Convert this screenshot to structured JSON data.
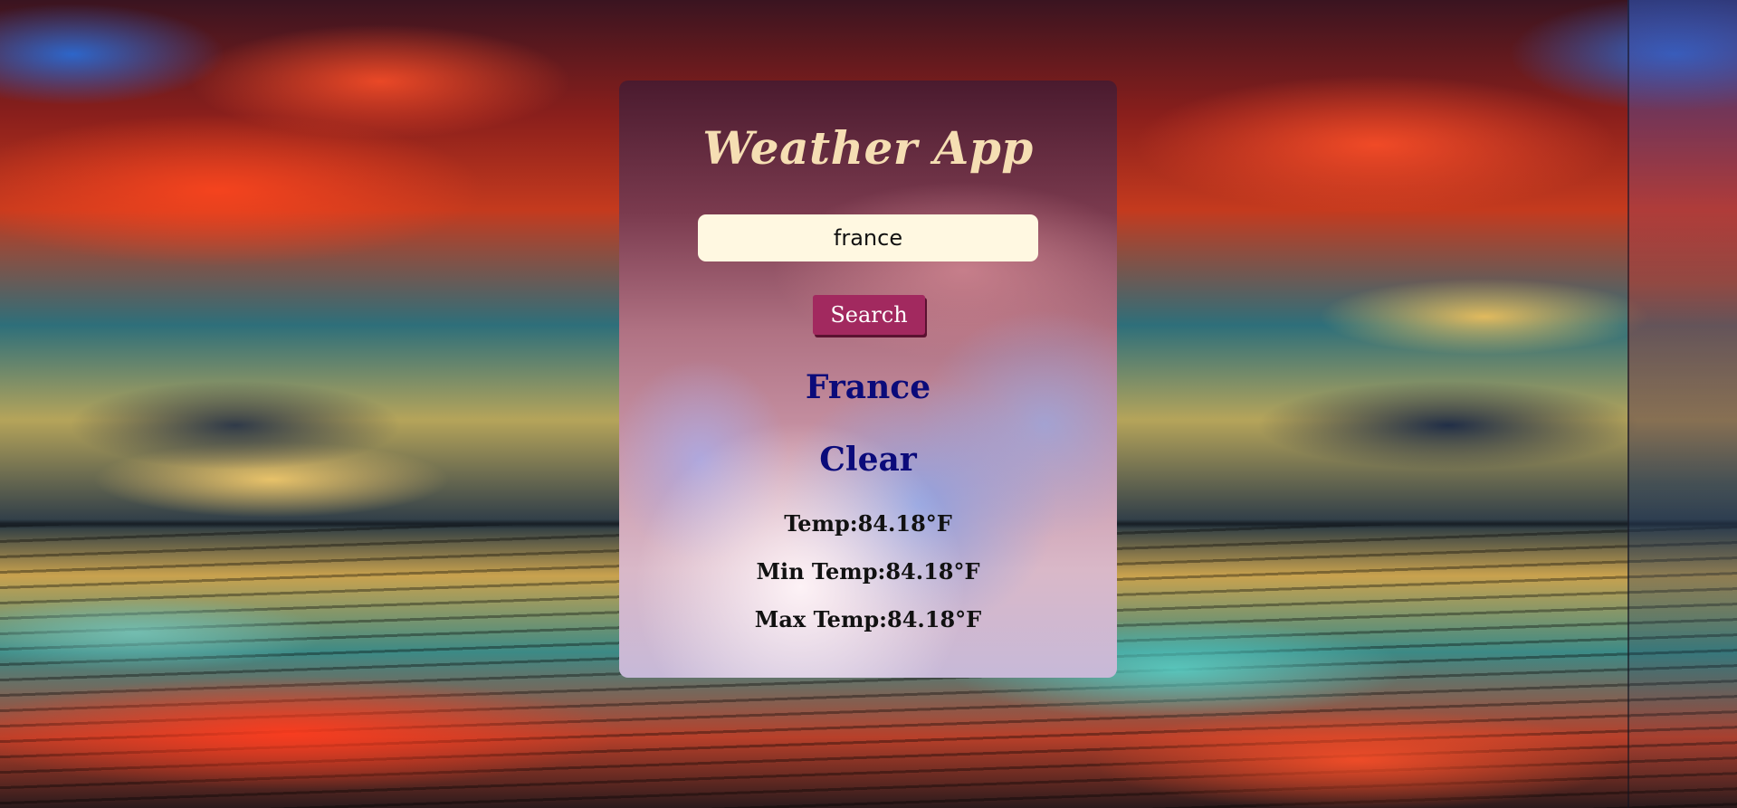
{
  "app": {
    "title": "Weather App"
  },
  "search": {
    "value": "france",
    "placeholder": "",
    "button_label": "Search"
  },
  "result": {
    "city": "France",
    "condition": "Clear",
    "temp_label": "Temp:",
    "temp_value": "84.18°F",
    "min_label": "Min Temp:",
    "min_value": "84.18°F",
    "max_label": "Max Temp:",
    "max_value": "84.18°F"
  },
  "colors": {
    "title": "#f5deb3",
    "button": "#a2295f",
    "input_bg": "#fff8e1",
    "heading_text": "#0b0b7a"
  }
}
